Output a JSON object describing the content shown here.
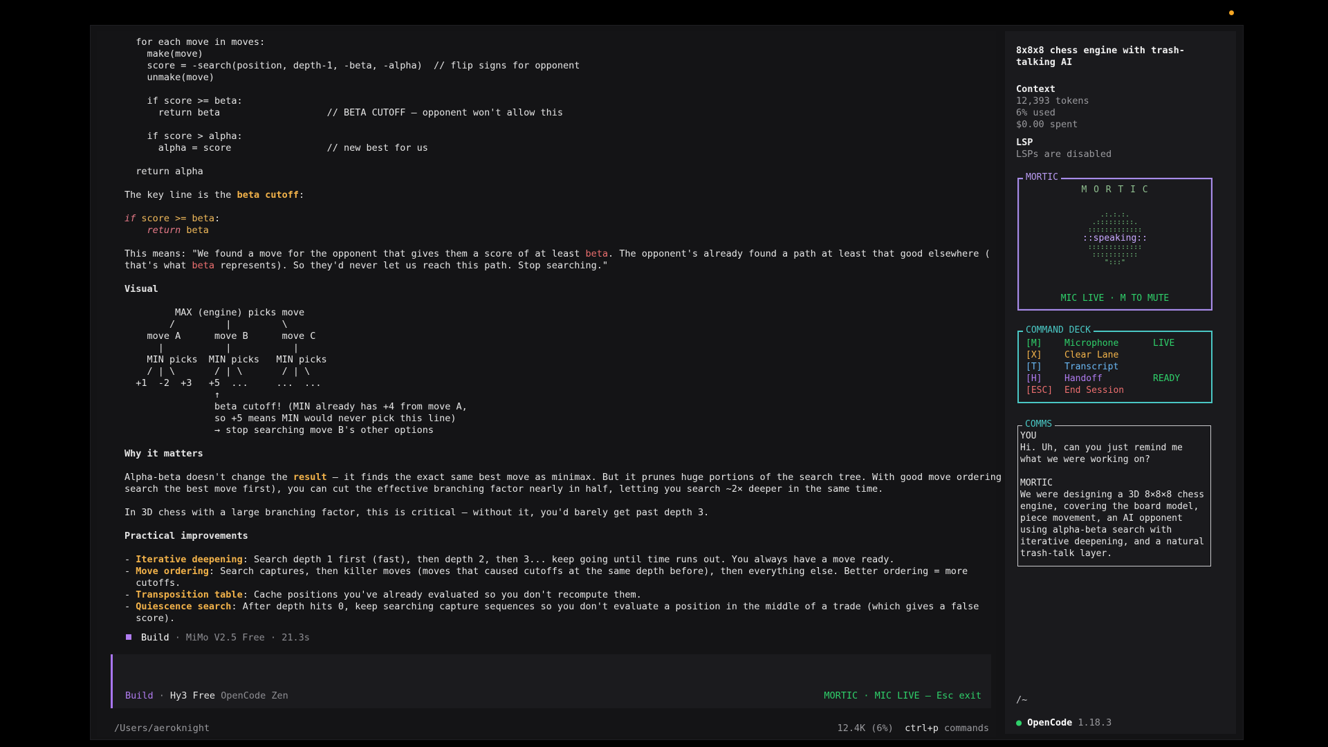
{
  "main": {
    "code1": [
      "  for each move in moves:",
      "    make(move)",
      "    score = -search(position, depth-1, -beta, -alpha)  // flip signs for opponent",
      "    unmake(move)",
      "",
      "    if score >= beta:",
      "      return beta                   // BETA CUTOFF — opponent won't allow this",
      "",
      "    if score > alpha:",
      "      alpha = score                 // new best for us",
      "",
      "  return alpha",
      ""
    ],
    "key_line_prefix": "The key line is the ",
    "key_line_term": "beta cutoff",
    "key_line_suffix": ":",
    "snippet_if": "if",
    "snippet_cond": " score >= beta",
    "snippet_colon": ":",
    "snippet_indent": "    ",
    "snippet_return": "return",
    "snippet_ret_val": " beta",
    "means_1a": "This means: \"We found a move for the opponent that gives them a score of at least ",
    "means_1b": "beta",
    "means_1c": ". The opponent's already found a path at least that good elsewhere (",
    "means_2a": "that's what ",
    "means_2b": "beta",
    "means_2c": " represents). So they'd never let us reach this path. Stop searching.\"",
    "visual_heading": "Visual",
    "diagram": [
      "         MAX (engine) picks move",
      "        /         |         \\",
      "    move A      move B      move C",
      "      |           |           |",
      "    MIN picks  MIN picks   MIN picks",
      "    / | \\       / | \\       / | \\",
      "  +1  -2  +3   +5  ...     ...  ...",
      "                ↑",
      "                beta cutoff! (MIN already has +4 from move A,",
      "                so +5 means MIN would never pick this line)",
      "                → stop searching move B's other options"
    ],
    "why_heading": "Why it matters",
    "why_1a": "Alpha-beta doesn't change the ",
    "why_1b": "result",
    "why_1c": " — it finds the exact same best move as minimax. But it prunes huge portions of the search tree. With good move ordering (",
    "why_2": "search the best move first), you can cut the effective branching factor nearly in half, letting you search ~2× deeper in the same time.",
    "why_3": "In 3D chess with a large branching factor, this is critical — without it, you'd barely get past depth 3.",
    "practical_heading": "Practical improvements",
    "bullets": [
      {
        "term": "Iterative deepening",
        "text": ": Search depth 1 first (fast), then depth 2, then 3... keep going until time runs out. You always have a move ready."
      },
      {
        "term": "Move ordering",
        "text": ": Search captures, then killer moves (moves that caused cutoffs at the same depth before), then everything else. Better ordering = more"
      },
      {
        "term": "Transposition table",
        "text": ": Cache positions you've already evaluated so you don't recompute them."
      },
      {
        "term": "Quiescence search",
        "text": ": After depth hits 0, keep searching capture sequences so you don't evaluate a position in the middle of a trade (which gives a false"
      }
    ],
    "bullet_cont_2": "  cutoffs.",
    "bullet_cont_4": "  score).",
    "bullet_dash": "- "
  },
  "build_line": {
    "label": "Build",
    "meta": " · MiMo V2.5 Free · 21.3s"
  },
  "input": {
    "mode": "Build",
    "sep": " · ",
    "model": "Hy3 Free",
    "provider": " OpenCode Zen",
    "right_status": "MORTIC · MIC LIVE — Esc exit"
  },
  "status": {
    "path": "/Users/aeroknight",
    "usage": "12.4K (6%)",
    "shortcut": "ctrl+p",
    "shortcut_label": " commands"
  },
  "sidebar": {
    "title": "8x8x8 chess engine with trash-talking AI",
    "context_heading": "Context",
    "tokens": "12,393 tokens",
    "used": "6% used",
    "spent": "$0.00 spent",
    "lsp_heading": "LSP",
    "lsp_status": "LSPs are disabled",
    "mortic_label": "MORTIC",
    "mortic_title": "M O R T I C",
    "orb_art": [
      "  .:.:.:.  ",
      " .:::::::::. ",
      ":::::::::::::",
      "::speaking::",
      ":::::::::::::",
      " ::::::::::: ",
      "   \":::\"   "
    ],
    "mortic_status": "MIC LIVE · M TO MUTE",
    "deck_label": "COMMAND DECK",
    "deck_items": [
      {
        "key": "[M]",
        "label": "Microphone",
        "state": "LIVE"
      },
      {
        "key": "[X]",
        "label": "Clear Lane",
        "state": ""
      },
      {
        "key": "[T]",
        "label": "Transcript",
        "state": ""
      },
      {
        "key": "[H]",
        "label": "Handoff",
        "state": "READY"
      },
      {
        "key": "[ESC]",
        "label": "End Session",
        "state": ""
      }
    ],
    "comms_label": "COMMS",
    "comms_you": "YOU",
    "comms_you_text": "Hi. Uh, can you just remind me what we were working on?",
    "comms_mortic": "MORTIC",
    "comms_mortic_text": "We were designing a 3D 8×8×8 chess engine, covering the board model, piece movement, an AI opponent using alpha-beta search with iterative deepening, and a natural trash-talk layer.",
    "cwd": "/~",
    "app_name": "OpenCode",
    "version": " 1.18.3"
  },
  "colors": {
    "accent_purple": "#b07cf0",
    "orange": "#f3b34a",
    "green": "#2fd06a",
    "cyan": "#4ac7c4",
    "red": "#ec6f6f"
  }
}
